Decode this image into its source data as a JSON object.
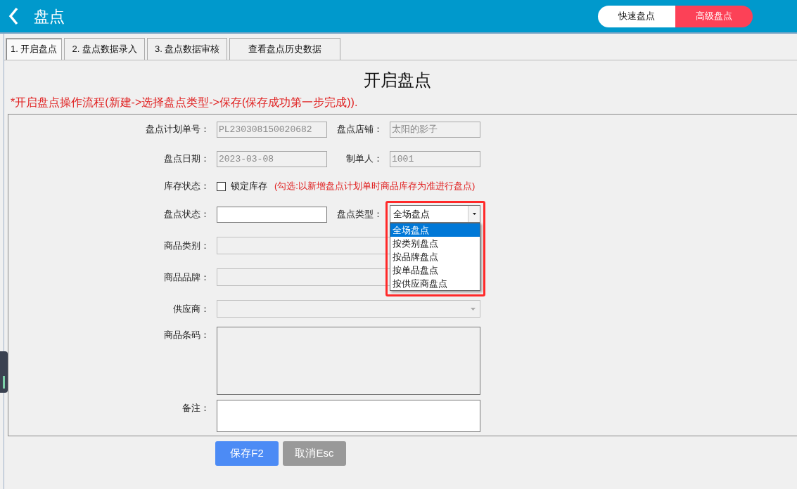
{
  "header": {
    "title": "盘点"
  },
  "mode_toggle": [
    {
      "label": "快速盘点",
      "selected": false
    },
    {
      "label": "高级盘点",
      "selected": true
    }
  ],
  "tabs": [
    {
      "label": "1. 开启盘点",
      "selected": true
    },
    {
      "label": "2. 盘点数据录入",
      "selected": false
    },
    {
      "label": "3. 盘点数据审核",
      "selected": false
    },
    {
      "label": "查看盘点历史数据",
      "selected": false
    }
  ],
  "heading": "开启盘点",
  "note": "*开启盘点操作流程(新建->选择盘点类型->保存(保存成功第一步完成)).",
  "form_rows": [
    {
      "items": [
        {
          "kind": "text",
          "label": "盘点计划单号：",
          "value": "PL230308150020682",
          "disabled": true
        },
        {
          "kind": "text",
          "label": "盘点店铺：",
          "value": "太阳的影子",
          "disabled": true
        }
      ]
    },
    {
      "items": [
        {
          "kind": "text",
          "label": "盘点日期：",
          "value": "2023-03-08",
          "disabled": true
        },
        {
          "kind": "text",
          "label": "制单人：",
          "value": "1001",
          "disabled": true
        }
      ]
    },
    {
      "items": [
        {
          "kind": "checkbox",
          "label": "库存状态：",
          "text": "锁定库存",
          "checked": false,
          "hint": "(勾选:以新增盘点计划单时商品库存为准进行盘点)"
        }
      ]
    },
    {
      "items": [
        {
          "kind": "text",
          "label": "盘点状态：",
          "disabled": false
        },
        {
          "kind": "select",
          "label": "盘点类型：",
          "value": "全场盘点",
          "disabled": false,
          "expanded": true,
          "highlighted": true,
          "options": [
            {
              "label": "全场盘点",
              "selected": true
            },
            {
              "label": "按类别盘点",
              "selected": false
            },
            {
              "label": "按品牌盘点",
              "selected": false
            },
            {
              "label": "按单品盘点",
              "selected": false
            },
            {
              "label": "按供应商盘点",
              "selected": false
            }
          ]
        }
      ]
    },
    {
      "items": [
        {
          "kind": "wide",
          "label": "商品类别：",
          "disabled": true
        }
      ]
    },
    {
      "items": [
        {
          "kind": "wide",
          "label": "商品品牌：",
          "disabled": true
        }
      ]
    },
    {
      "items": [
        {
          "kind": "wide-select",
          "label": "供应商：",
          "disabled": true
        }
      ]
    },
    {
      "items": [
        {
          "kind": "area",
          "label": "商品条码：",
          "disabled": true
        }
      ]
    },
    {
      "items": [
        {
          "kind": "note-area",
          "label": "备注：",
          "disabled": false
        }
      ]
    }
  ],
  "buttons": [
    {
      "kind": "primary",
      "label": "保存F2"
    },
    {
      "kind": "secondary",
      "label": "取消Esc"
    }
  ]
}
